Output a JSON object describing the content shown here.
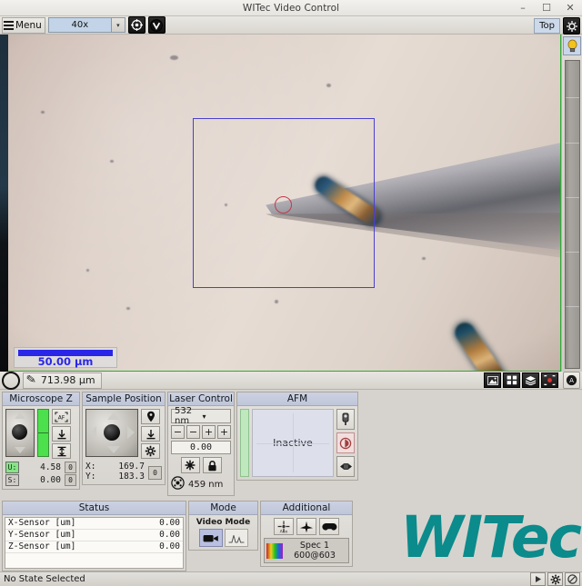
{
  "window": {
    "title": "WITec Video Control",
    "minimize": "–",
    "maximize": "☐",
    "close": "✕"
  },
  "toolbar": {
    "menu_label": "Menu",
    "objective": "40x",
    "objective_arrow": "▾",
    "target_icon": "target-icon",
    "v_icon": "V",
    "top_label": "Top",
    "camera_icon": "gear-icon"
  },
  "video": {
    "scale_bar_label": "50.00 µm",
    "bulb_icon": "lightbulb-icon"
  },
  "viewbar": {
    "circle_icon": "circle-icon",
    "pencil_icon": "✎",
    "measure_value": "713.98 µm",
    "icons": [
      "image-icon",
      "grid-icon",
      "layers-icon",
      "record-target-icon",
      "settings-a-icon"
    ]
  },
  "microscope_z": {
    "title": "Microscope Z",
    "af_label": "AF",
    "approach_icon": "arrow-down-icon",
    "range_icon": "arrow-updown-icon",
    "rows": [
      {
        "badge": "U:",
        "value": "4.58",
        "unit": "0"
      },
      {
        "badge": "S:",
        "value": "0.00",
        "unit": "0"
      }
    ]
  },
  "sample_position": {
    "title": "Sample Position",
    "pin_icon": "map-pin-icon",
    "down_icon": "arrow-down-icon",
    "gear_icon": "gear-icon",
    "rows": [
      {
        "label": "X:",
        "value": "169.7"
      },
      {
        "label": "Y:",
        "value": "183.3"
      }
    ],
    "zero_chip": "0"
  },
  "laser_control": {
    "title": "Laser Control",
    "wavelength": "532 nm",
    "dropdown_arrow": "▾",
    "buttons": [
      "−",
      "−",
      "+",
      "+"
    ],
    "power_value": "0.00",
    "laser_icon": "laser-icon",
    "lock_icon": "lock-icon",
    "aperture_icon": "aperture-icon",
    "secondary_wavelength": "459 nm"
  },
  "afm": {
    "title": "AFM",
    "state": "Inactive",
    "buttons": [
      "tip-icon",
      "feedback-icon",
      "move-icon"
    ]
  },
  "status_panel": {
    "title": "Status",
    "rows": [
      {
        "label": "X-Sensor [um]",
        "value": "0.00"
      },
      {
        "label": "Y-Sensor [um]",
        "value": "0.00"
      },
      {
        "label": "Z-Sensor [um]",
        "value": "0.00"
      }
    ]
  },
  "mode_panel": {
    "title": "Mode",
    "active_label": "Video Mode",
    "video_icon": "video-camera-icon",
    "spectrum_icon": "spectrum-icon"
  },
  "additional_panel": {
    "title": "Additional",
    "aux_label": "Aux",
    "aux_icon": "aux-icon",
    "plane_icon": "airplane-icon",
    "gamepad_icon": "gamepad-icon",
    "spec_name": "Spec 1",
    "spec_value": "600@603"
  },
  "brand": {
    "logo_text": "WITec",
    "logo_color": "#0b8b8b"
  },
  "statusbar": {
    "text": "No State Selected",
    "play_icon": "play-icon",
    "gear_icon": "gear-icon",
    "ban_icon": "ban-icon"
  }
}
